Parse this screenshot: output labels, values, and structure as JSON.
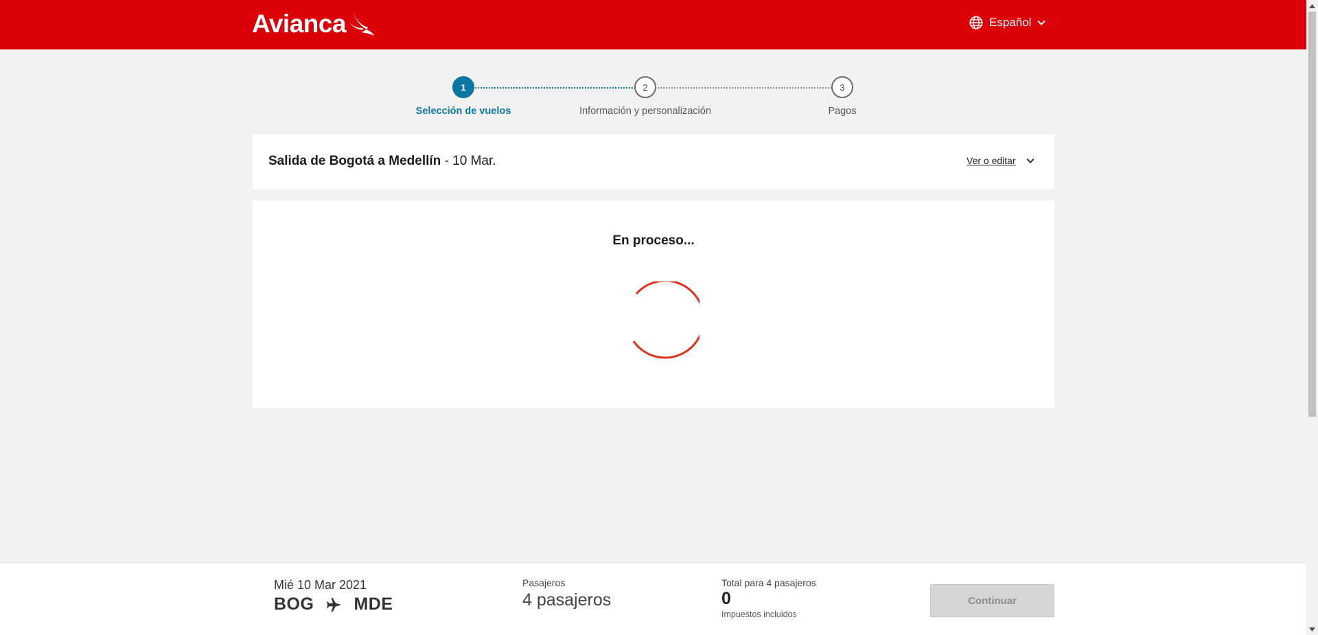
{
  "header": {
    "logo_text": "Avianca",
    "language": "Español"
  },
  "stepper": {
    "steps": [
      {
        "number": "1",
        "label": "Selección de vuelos",
        "active": true
      },
      {
        "number": "2",
        "label": "Información y personalización",
        "active": false
      },
      {
        "number": "3",
        "label": "Pagos",
        "active": false
      }
    ]
  },
  "flight_summary": {
    "title": "Salida de Bogotá a Medellín",
    "date_suffix": " - 10 Mar.",
    "edit_label": "Ver o editar"
  },
  "loading": {
    "status_text": "En proceso..."
  },
  "bottom_bar": {
    "date": "Mié 10 Mar 2021",
    "origin": "BOG",
    "destination": "MDE",
    "passengers_label": "Pasajeros",
    "passengers_value": "4 pasajeros",
    "total_label": "Total para 4 pasajeros",
    "total_value": "0",
    "tax_note": "Impuestos incluidos",
    "continue_label": "Continuar"
  },
  "colors": {
    "brand_red": "#dc0009",
    "step_active": "#0a77a3",
    "spinner": "#e0301e",
    "button_disabled": "#d5d5d5"
  },
  "icons": {
    "language": "globe-icon",
    "dropdown": "chevron-down-icon",
    "route": "airplane-icon",
    "logo_mark": "bird-icon",
    "loader": "spinner-icon"
  }
}
